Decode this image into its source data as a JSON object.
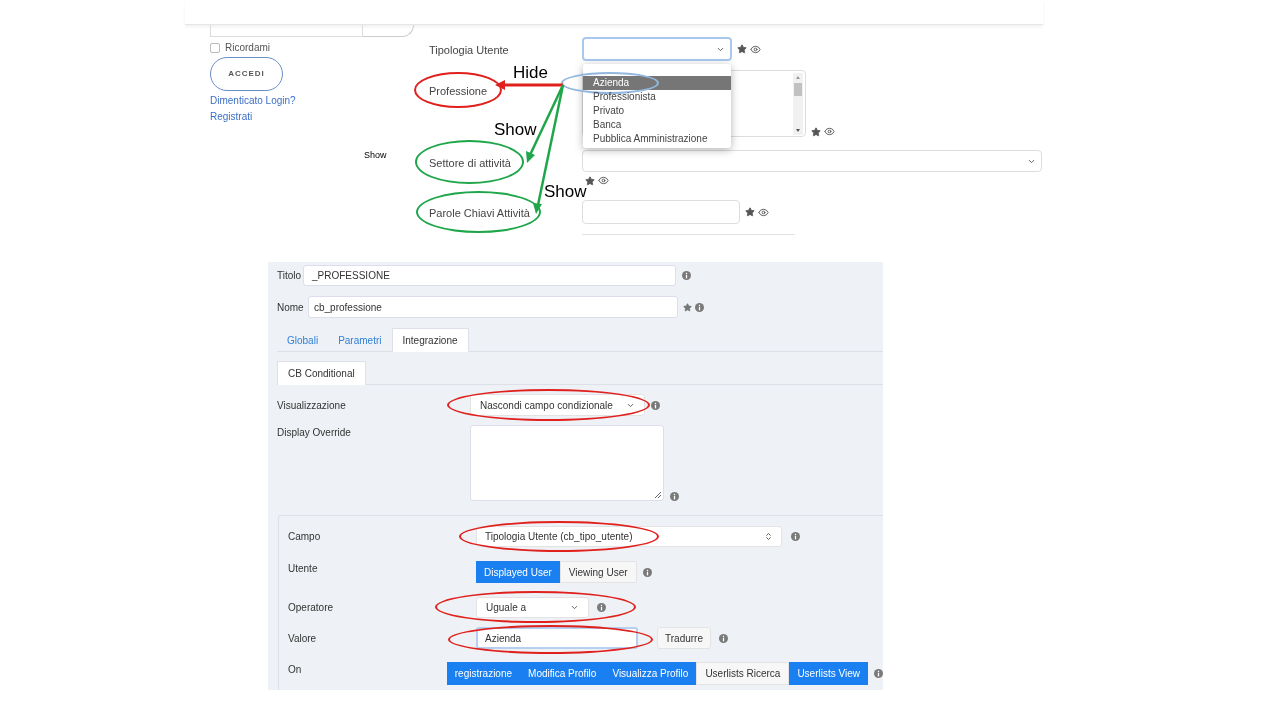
{
  "login": {
    "remember": {
      "label": "Ricordami",
      "checked": false
    },
    "login_button": "ACCEDI",
    "links": [
      "Dimenticato Login?",
      "Registrati"
    ]
  },
  "profile_form": {
    "fields": [
      {
        "label": "Tipologia Utente",
        "kind": "select"
      },
      {
        "label": "Professione",
        "kind": "textarea",
        "color": "#e0201c"
      },
      {
        "label": "Settore di attività",
        "kind": "wide_select",
        "color": "#1fa64a"
      },
      {
        "label": "Parole Chiavi Attività",
        "kind": "input",
        "color": "#1fa64a"
      }
    ],
    "dropdown": {
      "options": [
        {
          "label": "Azienda",
          "selected": true,
          "circled": true
        },
        {
          "label": "Professionista",
          "selected": false
        },
        {
          "label": "Privato",
          "selected": false
        },
        {
          "label": "Banca",
          "selected": false
        },
        {
          "label": "Pubblica Amministrazione",
          "selected": false
        }
      ]
    }
  },
  "slide_labels": [
    {
      "text": "Hide",
      "kind": "large"
    },
    {
      "text": "Show",
      "kind": "large"
    },
    {
      "text": "Show",
      "kind": "large"
    },
    {
      "text": "Show",
      "kind": "small"
    }
  ],
  "field_editor": {
    "titolo": {
      "label": "Titolo",
      "value": "_PROFESSIONE",
      "required": false
    },
    "nome": {
      "label": "Nome",
      "value": "cb_professione",
      "required": true
    },
    "tabs": [
      {
        "label": "Globali",
        "selected": false
      },
      {
        "label": "Parametri",
        "selected": false
      },
      {
        "label": "Integrazione",
        "selected": true
      }
    ],
    "subtabs": [
      {
        "label": "CB Conditional",
        "selected": true
      }
    ],
    "visualizzazione": {
      "label": "Visualizzazione",
      "value": "Nascondi campo condizionale",
      "circled": true
    },
    "display_override": {
      "label": "Display Override"
    },
    "condition": {
      "campo": {
        "label": "Campo",
        "value": "Tipologia Utente (cb_tipo_utente)",
        "circled": true
      },
      "utente": {
        "label": "Utente",
        "options": [
          {
            "label": "Displayed User",
            "selected": true
          },
          {
            "label": "Viewing User",
            "selected": false
          }
        ]
      },
      "operatore": {
        "label": "Operatore",
        "value": "Uguale a",
        "circled": true
      },
      "valore": {
        "label": "Valore",
        "value": "Azienda",
        "circled": true,
        "translate_button": "Tradurre"
      },
      "on": {
        "label": "On",
        "options": [
          {
            "label": "registrazione",
            "selected": true
          },
          {
            "label": "Modifica Profilo",
            "selected": true
          },
          {
            "label": "Visualizza Profilo",
            "selected": true
          },
          {
            "label": "Userlists Ricerca",
            "selected": false
          },
          {
            "label": "Userlists View",
            "selected": true
          }
        ]
      }
    }
  }
}
